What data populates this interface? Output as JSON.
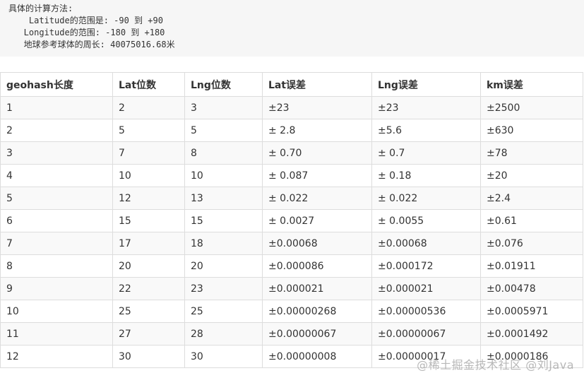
{
  "intro": {
    "lines": [
      "具体的计算方法:",
      "    Latitude的范围是: -90 到 +90",
      "   Longitude的范围: -180 到 +180",
      "   地球参考球体的周长: 40075016.68米"
    ]
  },
  "table": {
    "headers": [
      "geohash长度",
      "Lat位数",
      "Lng位数",
      "Lat误差",
      "Lng误差",
      "km误差"
    ],
    "rows": [
      [
        "1",
        "2",
        "3",
        "±23",
        "±23",
        "±2500"
      ],
      [
        "2",
        "5",
        "5",
        "± 2.8",
        "±5.6",
        "±630"
      ],
      [
        "3",
        "7",
        "8",
        "± 0.70",
        "± 0.7",
        "±78"
      ],
      [
        "4",
        "10",
        "10",
        "± 0.087",
        "± 0.18",
        "±20"
      ],
      [
        "5",
        "12",
        "13",
        "± 0.022",
        "± 0.022",
        "±2.4"
      ],
      [
        "6",
        "15",
        "15",
        "± 0.0027",
        "± 0.0055",
        "±0.61"
      ],
      [
        "7",
        "17",
        "18",
        "±0.00068",
        "±0.00068",
        "±0.076"
      ],
      [
        "8",
        "20",
        "20",
        "±0.000086",
        "±0.000172",
        "±0.01911"
      ],
      [
        "9",
        "22",
        "23",
        "±0.000021",
        "±0.000021",
        "±0.00478"
      ],
      [
        "10",
        "25",
        "25",
        "±0.00000268",
        "±0.00000536",
        "±0.0005971"
      ],
      [
        "11",
        "27",
        "28",
        "±0.00000067",
        "±0.00000067",
        "±0.0001492"
      ],
      [
        "12",
        "30",
        "30",
        "±0.00000008",
        "±0.00000017",
        "±0.0000186"
      ]
    ]
  },
  "watermark": "@稀土掘金技术社区 @刘Java"
}
